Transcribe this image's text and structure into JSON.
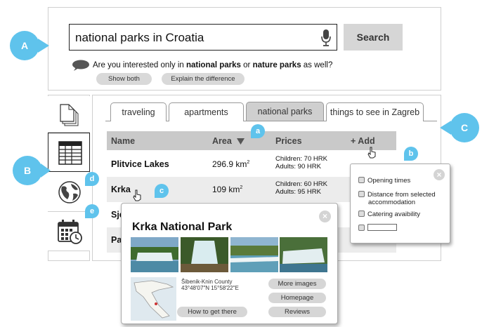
{
  "search": {
    "query": "national parks in Croatia",
    "button_label": "Search"
  },
  "suggestion": {
    "prefix": "Are you interested only in ",
    "bold1": "national parks",
    "middle": " or ",
    "bold2": "nature parks",
    "suffix": " as well?",
    "buttons": [
      "Show both",
      "Explain the difference"
    ]
  },
  "tabs": [
    {
      "label": "traveling",
      "active": false
    },
    {
      "label": "apartments",
      "active": false
    },
    {
      "label": "national parks",
      "active": true
    },
    {
      "label": "things to see in Zagreb",
      "active": false
    }
  ],
  "table": {
    "columns": [
      "Name",
      "Area",
      "Prices",
      "+ Add"
    ],
    "rows": [
      {
        "name": "Plitvice Lakes",
        "area": "296.9 km",
        "price1": "Children: 70 HRK",
        "price2": "Adults: 90 HRK"
      },
      {
        "name": "Krka",
        "area": "109 km",
        "price1": "Children: 60 HRK",
        "price2": "Adults: 95 HRK"
      },
      {
        "name": "Sje",
        "area": "",
        "price1": "",
        "price2": ""
      },
      {
        "name": "Pa",
        "area": "",
        "price1": "",
        "price2": ""
      }
    ],
    "area_superscript": "2"
  },
  "add_popup": {
    "options": [
      "Opening times",
      "Distance from selected",
      "accommodation",
      "Catering avaibility"
    ],
    "close": "×"
  },
  "detail_popup": {
    "title": "Krka National Park",
    "location_line1": "Šibenik-Knin County",
    "location_line2": "43°48′07″N 15°58′22″E",
    "buttons": [
      "More images",
      "Homepage",
      "Reviews",
      "How to get there"
    ],
    "close": "×"
  },
  "annotations": {
    "big": [
      "A",
      "B",
      "C"
    ],
    "small": [
      "a",
      "b",
      "c",
      "c",
      "d",
      "e"
    ]
  },
  "colors": {
    "annotation": "#5fc3ec",
    "header_gray": "#c9c9c9",
    "button_gray": "#d6d6d6"
  },
  "icons": [
    "microphone-icon",
    "speech-bubble-icon",
    "document-icon",
    "table-icon",
    "globe-icon",
    "calendar-clock-icon",
    "sort-down-icon",
    "hand-cursor-icon",
    "close-icon"
  ]
}
